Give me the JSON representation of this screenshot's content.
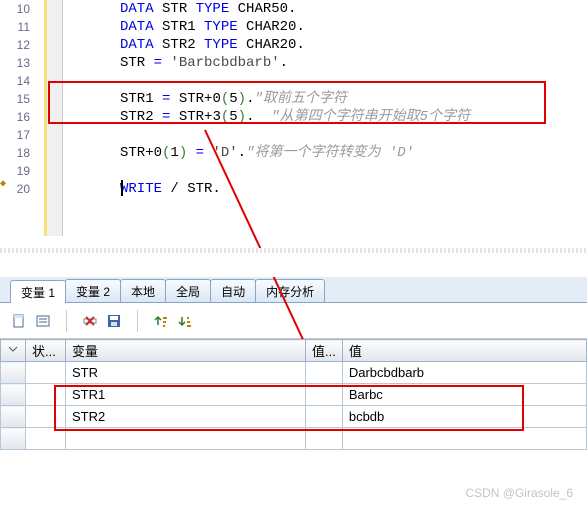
{
  "code": {
    "lines": [
      {
        "n": "10",
        "html": "<span class='kw'>DATA</span> STR <span class='kw'>TYPE</span> CHAR50."
      },
      {
        "n": "11",
        "html": "<span class='kw'>DATA</span> STR1 <span class='kw'>TYPE</span> CHAR20."
      },
      {
        "n": "12",
        "html": "<span class='kw'>DATA</span> STR2 <span class='kw'>TYPE</span> CHAR20."
      },
      {
        "n": "13",
        "html": "STR <span class='kw'>=</span> <span class='str'>'Barbcbdbarb'</span>."
      },
      {
        "n": "14",
        "html": ""
      },
      {
        "n": "15",
        "html": "STR1 <span class='kw'>=</span> STR+<span class='num'>0</span><span class='paren'>(</span><span class='num'>5</span><span class='paren'>)</span>.<span class='comment'>\"取前五个字符</span>"
      },
      {
        "n": "16",
        "html": "STR2 <span class='kw'>=</span> STR+<span class='num'>3</span><span class='paren'>(</span><span class='num'>5</span><span class='paren'>)</span>.  <span class='comment'>\"从第四个字符串开始取5个字符</span>"
      },
      {
        "n": "17",
        "html": ""
      },
      {
        "n": "18",
        "html": "STR+<span class='num'>0</span><span class='paren'>(</span><span class='num'>1</span><span class='paren'>)</span> <span class='kw'>=</span> <span class='str'>'D'</span>.<span class='comment'>\"将第一个字符转变为 'D'</span>"
      },
      {
        "n": "19",
        "html": ""
      },
      {
        "n": "20",
        "html": "<span class='kw'>WRITE</span> / STR."
      }
    ]
  },
  "tabs": {
    "items": [
      {
        "label": "变量 1",
        "active": true
      },
      {
        "label": "变量 2",
        "active": false
      },
      {
        "label": "本地",
        "active": false
      },
      {
        "label": "全局",
        "active": false
      },
      {
        "label": "自动",
        "active": false
      },
      {
        "label": "内存分析",
        "active": false
      }
    ]
  },
  "grid": {
    "headers": {
      "state": "状...",
      "variable": "变量",
      "vi": "值...",
      "value": "值"
    },
    "rows": [
      {
        "var": "STR",
        "val": "Darbcbdbarb"
      },
      {
        "var": "STR1",
        "val": "Barbc"
      },
      {
        "var": "STR2",
        "val": "bcbdb"
      },
      {
        "var": "",
        "val": ""
      }
    ]
  },
  "watermark": "CSDN @Girasole_6",
  "icons": {
    "new": "new-doc-icon",
    "open": "open-icon",
    "delete": "delete-icon",
    "save": "save-icon",
    "sort_asc": "sort-asc-icon",
    "sort_desc": "sort-desc-icon",
    "dropdown": "dropdown-icon",
    "select": "select-icon"
  }
}
